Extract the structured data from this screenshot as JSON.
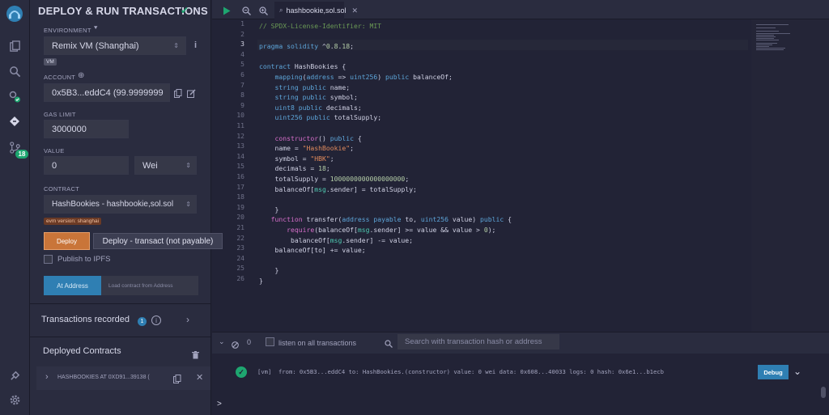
{
  "panel": {
    "title": "DEPLOY & RUN TRANSACTIONS",
    "environment_label": "ENVIRONMENT",
    "environment_value": "Remix VM (Shanghai)",
    "environment_tag": "VM",
    "account_label": "ACCOUNT",
    "account_value": "0x5B3...eddC4 (99.9999999",
    "gas_limit_label": "GAS LIMIT",
    "gas_limit_value": "3000000",
    "value_label": "VALUE",
    "value_amount": "0",
    "value_unit": "Wei",
    "contract_label": "CONTRACT",
    "contract_value": "HashBookies - hashbookie,sol.sol",
    "evm_tag": "evm version: shanghai",
    "deploy_label": "Deploy",
    "deploy_tooltip": "Deploy - transact (not payable)",
    "publish_label": "Publish to IPFS",
    "at_address_label": "At Address",
    "load_contract_label": "Load contract from Address",
    "transactions_recorded_label": "Transactions recorded",
    "transactions_recorded_count": "1",
    "deployed_contracts_label": "Deployed Contracts",
    "deployed_item": "HASHBOOKIES AT 0XD91...39138 ("
  },
  "iconbar": {
    "git_badge": "18"
  },
  "editor": {
    "tab_label": "hashbookie,sol.sol",
    "current_line": 3,
    "lines": [
      "// SPDX-License-Identifier: MIT",
      "",
      "pragma solidity ^0.8.18;",
      "",
      "contract HashBookies {",
      "    mapping(address => uint256) public balanceOf;",
      "    string public name;",
      "    string public symbol;",
      "    uint8 public decimals;",
      "    uint256 public totalSupply;",
      "",
      "    constructor() public {",
      "    name = \"HashBookie\";",
      "    symbol = \"HBK\";",
      "    decimals = 18;",
      "    totalSupply = 1000000000000000000;",
      "    balanceOf[msg.sender] = totalSupply;",
      "",
      "    }",
      "   function transfer(address payable to, uint256 value) public {",
      "       require(balanceOf[msg.sender] >= value && value > 0);",
      "        balanceOf[msg.sender] -= value;",
      "    balanceOf[to] += value;",
      "",
      "    }",
      "}"
    ]
  },
  "terminal": {
    "count": "0",
    "listen_label": "listen on all transactions",
    "search_placeholder": "Search with transaction hash or address",
    "log_line": "[vm]  from: 0x5B3...eddC4 to: HashBookies.(constructor) value: 0 wei data: 0x608...40033 logs: 0 hash: 0x6e1...b1ecb",
    "debug_label": "Debug",
    "prompt": ">"
  },
  "colors": {
    "accent": "#c97539",
    "primary": "#2f7fb3",
    "success": "#1ea670"
  }
}
